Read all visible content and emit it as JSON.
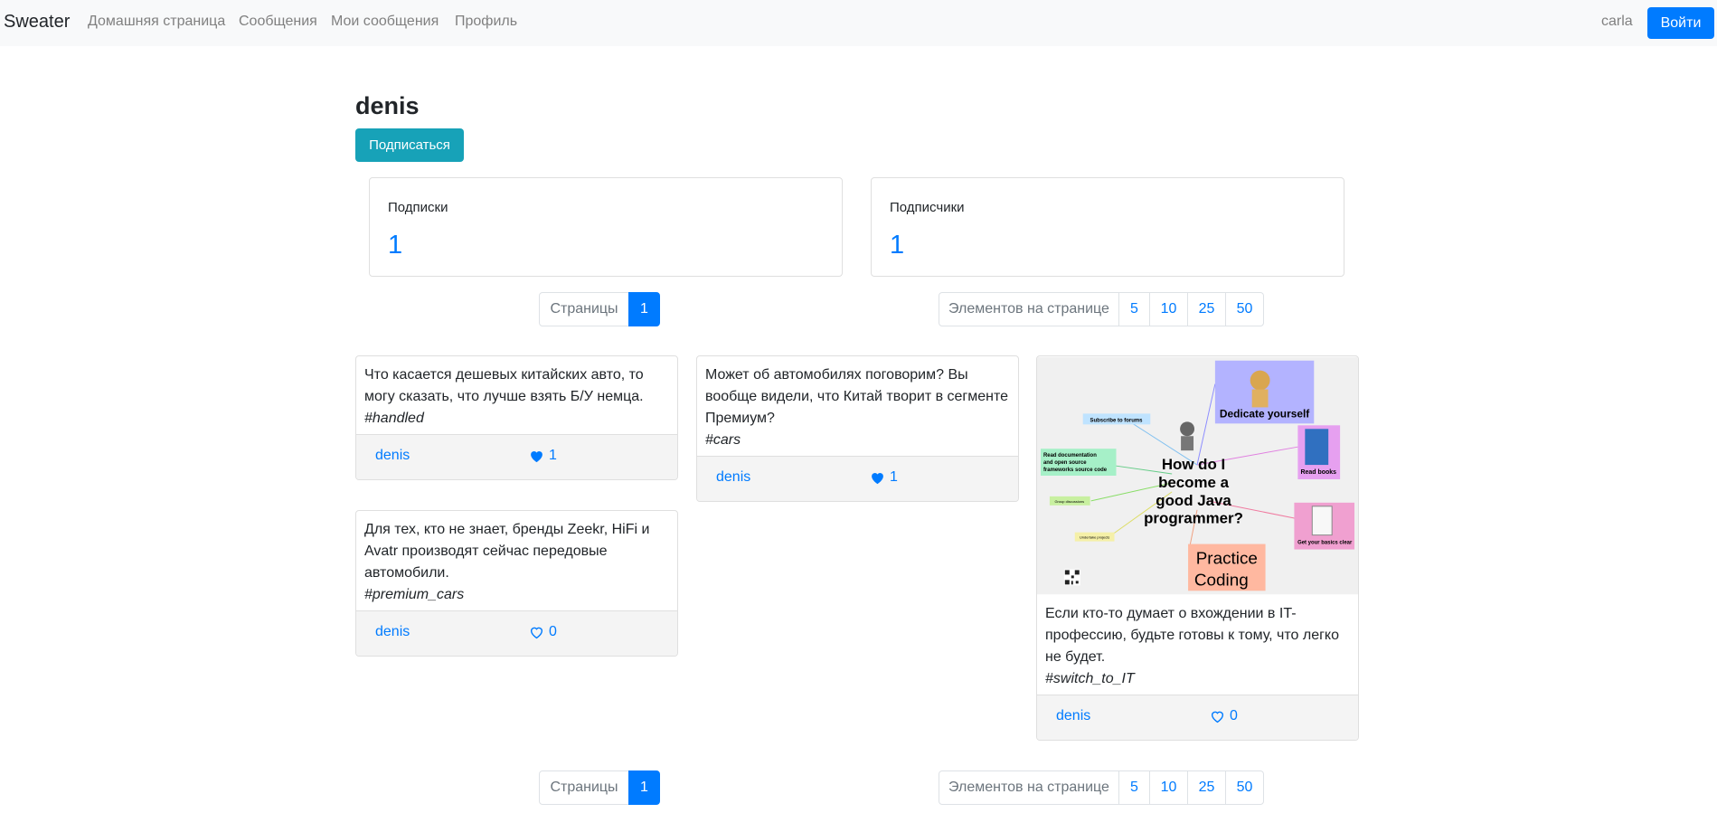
{
  "navbar": {
    "brand": "Sweater",
    "links": [
      "Домашняя страница",
      "Сообщения",
      "Мои сообщения",
      "Профиль"
    ],
    "user": "carla",
    "login_label": "Войти"
  },
  "profile": {
    "name": "denis",
    "subscribe_label": "Подписаться",
    "subscriptions_label": "Подписки",
    "subscriptions_count": "1",
    "subscribers_label": "Подписчики",
    "subscribers_count": "1"
  },
  "pagination": {
    "pages_label": "Страницы",
    "current_page": "1",
    "per_page_label": "Элементов на странице",
    "per_page_options": [
      "5",
      "10",
      "25",
      "50"
    ]
  },
  "messages": [
    {
      "text": "Что касается дешевых китайских авто, то могу сказать, что лучше взять Б/У немца.",
      "tag": "#handled",
      "author": "denis",
      "likes": "1",
      "liked": true
    },
    {
      "text": "Для тех, кто не знает, бренды Zeekr, HiFi и Avatr производят сейчас передовые автомобили.",
      "tag": "#premium_cars",
      "author": "denis",
      "likes": "0",
      "liked": false
    },
    {
      "text": "Может об автомобилях поговорим? Вы вообще видели, что Китай творит в сегменте Премиум?",
      "tag": "#cars",
      "author": "denis",
      "likes": "1",
      "liked": true
    },
    {
      "text": "Если кто-то думает о вхождении в IT-профессию, будьте готовы к тому, что легко не будет.",
      "tag": "#switch_to_IT",
      "author": "denis",
      "likes": "0",
      "liked": false,
      "image": {
        "title": [
          "How do I",
          "become a",
          "good Java",
          "programmer?"
        ],
        "dedicate": "Dedicate yourself",
        "read_books": "Read books",
        "basics": "Get your basics clear",
        "practice": [
          "Practice",
          "Coding"
        ],
        "subscribe": "Subscribe to forums",
        "read_docs": [
          "Read documentation",
          "and open source",
          "frameworks source code"
        ],
        "group": "Group discussions",
        "projects": "Undertake projects"
      }
    }
  ],
  "colors": {
    "primary": "#007bff",
    "info": "#17a2b8",
    "navbar": "#f8f9fa"
  }
}
